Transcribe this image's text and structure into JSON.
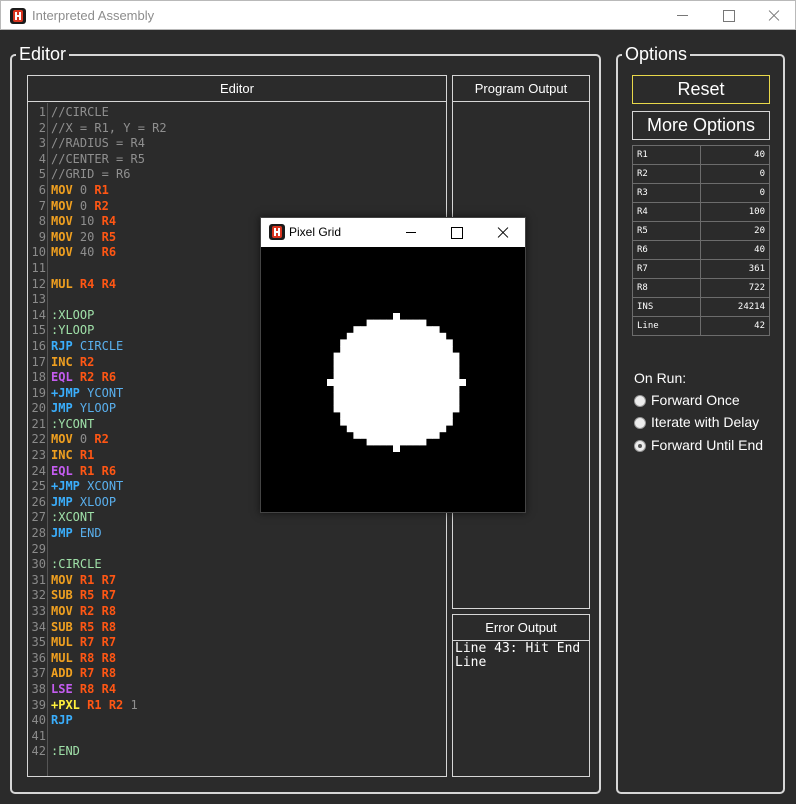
{
  "window": {
    "title": "Interpreted Assembly"
  },
  "editor_group": {
    "label": "Editor"
  },
  "options_group": {
    "label": "Options"
  },
  "editor_panel": {
    "header": "Editor",
    "lines": [
      {
        "n": "1",
        "t": [
          [
            "comment",
            "//CIRCLE"
          ]
        ]
      },
      {
        "n": "2",
        "t": [
          [
            "comment",
            "//X = R1, Y = R2"
          ]
        ]
      },
      {
        "n": "3",
        "t": [
          [
            "comment",
            "//RADIUS = R4"
          ]
        ]
      },
      {
        "n": "4",
        "t": [
          [
            "comment",
            "//CENTER = R5"
          ]
        ]
      },
      {
        "n": "5",
        "t": [
          [
            "comment",
            "//GRID = R6"
          ]
        ]
      },
      {
        "n": "6",
        "t": [
          [
            "t-orange",
            "MOV"
          ],
          [
            "t-num",
            "0"
          ],
          [
            "t-reg",
            "R1"
          ]
        ]
      },
      {
        "n": "7",
        "t": [
          [
            "t-orange",
            "MOV"
          ],
          [
            "t-num",
            "0"
          ],
          [
            "t-reg",
            "R2"
          ]
        ]
      },
      {
        "n": "8",
        "t": [
          [
            "t-orange",
            "MOV"
          ],
          [
            "t-num",
            "10"
          ],
          [
            "t-reg",
            "R4"
          ]
        ]
      },
      {
        "n": "9",
        "t": [
          [
            "t-orange",
            "MOV"
          ],
          [
            "t-num",
            "20"
          ],
          [
            "t-reg",
            "R5"
          ]
        ]
      },
      {
        "n": "10",
        "t": [
          [
            "t-orange",
            "MOV"
          ],
          [
            "t-num",
            "40"
          ],
          [
            "t-reg",
            "R6"
          ]
        ]
      },
      {
        "n": "11",
        "t": []
      },
      {
        "n": "12",
        "t": [
          [
            "t-orange",
            "MUL"
          ],
          [
            "t-reg",
            "R4"
          ],
          [
            "t-reg",
            "R4"
          ]
        ]
      },
      {
        "n": "13",
        "t": []
      },
      {
        "n": "14",
        "t": [
          [
            "t-green",
            ":XLOOP"
          ]
        ]
      },
      {
        "n": "15",
        "t": [
          [
            "t-green",
            ":YLOOP"
          ]
        ]
      },
      {
        "n": "16",
        "t": [
          [
            "t-blue",
            "RJP"
          ],
          [
            "t-label",
            "CIRCLE"
          ]
        ]
      },
      {
        "n": "17",
        "t": [
          [
            "t-orange",
            "INC"
          ],
          [
            "t-reg",
            "R2"
          ]
        ]
      },
      {
        "n": "18",
        "t": [
          [
            "t-purple",
            "EQL"
          ],
          [
            "t-reg",
            "R2"
          ],
          [
            "t-reg",
            "R6"
          ]
        ]
      },
      {
        "n": "19",
        "t": [
          [
            "t-blue",
            "+JMP"
          ],
          [
            "t-label",
            "YCONT"
          ]
        ]
      },
      {
        "n": "20",
        "t": [
          [
            "t-blue",
            "JMP"
          ],
          [
            "t-label",
            "YLOOP"
          ]
        ]
      },
      {
        "n": "21",
        "t": [
          [
            "t-green",
            ":YCONT"
          ]
        ]
      },
      {
        "n": "22",
        "t": [
          [
            "t-orange",
            "MOV"
          ],
          [
            "t-num",
            "0"
          ],
          [
            "t-reg",
            "R2"
          ]
        ]
      },
      {
        "n": "23",
        "t": [
          [
            "t-orange",
            "INC"
          ],
          [
            "t-reg",
            "R1"
          ]
        ]
      },
      {
        "n": "24",
        "t": [
          [
            "t-purple",
            "EQL"
          ],
          [
            "t-reg",
            "R1"
          ],
          [
            "t-reg",
            "R6"
          ]
        ]
      },
      {
        "n": "25",
        "t": [
          [
            "t-blue",
            "+JMP"
          ],
          [
            "t-label",
            "XCONT"
          ]
        ]
      },
      {
        "n": "26",
        "t": [
          [
            "t-blue",
            "JMP"
          ],
          [
            "t-label",
            "XLOOP"
          ]
        ]
      },
      {
        "n": "27",
        "t": [
          [
            "t-green",
            ":XCONT"
          ]
        ]
      },
      {
        "n": "28",
        "t": [
          [
            "t-blue",
            "JMP"
          ],
          [
            "t-label",
            "END"
          ]
        ]
      },
      {
        "n": "29",
        "t": []
      },
      {
        "n": "30",
        "t": [
          [
            "t-green",
            ":CIRCLE"
          ]
        ]
      },
      {
        "n": "31",
        "t": [
          [
            "t-orange",
            "MOV"
          ],
          [
            "t-reg",
            "R1"
          ],
          [
            "t-reg",
            "R7"
          ]
        ]
      },
      {
        "n": "32",
        "t": [
          [
            "t-orange",
            "SUB"
          ],
          [
            "t-reg",
            "R5"
          ],
          [
            "t-reg",
            "R7"
          ]
        ]
      },
      {
        "n": "33",
        "t": [
          [
            "t-orange",
            "MOV"
          ],
          [
            "t-reg",
            "R2"
          ],
          [
            "t-reg",
            "R8"
          ]
        ]
      },
      {
        "n": "34",
        "t": [
          [
            "t-orange",
            "SUB"
          ],
          [
            "t-reg",
            "R5"
          ],
          [
            "t-reg",
            "R8"
          ]
        ]
      },
      {
        "n": "35",
        "t": [
          [
            "t-orange",
            "MUL"
          ],
          [
            "t-reg",
            "R7"
          ],
          [
            "t-reg",
            "R7"
          ]
        ]
      },
      {
        "n": "36",
        "t": [
          [
            "t-orange",
            "MUL"
          ],
          [
            "t-reg",
            "R8"
          ],
          [
            "t-reg",
            "R8"
          ]
        ]
      },
      {
        "n": "37",
        "t": [
          [
            "t-orange",
            "ADD"
          ],
          [
            "t-reg",
            "R7"
          ],
          [
            "t-reg",
            "R8"
          ]
        ]
      },
      {
        "n": "38",
        "t": [
          [
            "t-purple",
            "LSE"
          ],
          [
            "t-reg",
            "R8"
          ],
          [
            "t-reg",
            "R4"
          ]
        ]
      },
      {
        "n": "39",
        "t": [
          [
            "t-yellow",
            "+PXL"
          ],
          [
            "t-reg",
            "R1"
          ],
          [
            "t-reg",
            "R2"
          ],
          [
            "t-num",
            "1"
          ]
        ]
      },
      {
        "n": "40",
        "t": [
          [
            "t-blue",
            "RJP"
          ]
        ]
      },
      {
        "n": "41",
        "t": []
      },
      {
        "n": "42",
        "t": [
          [
            "t-green",
            ":END"
          ]
        ]
      }
    ]
  },
  "program_output": {
    "header": "Program Output",
    "text": ""
  },
  "error_output": {
    "header": "Error Output",
    "text": "Line 43: Hit End Line"
  },
  "pixel_grid": {
    "title": "Pixel Grid",
    "grid_size": 40,
    "center": 20,
    "radius_squared": 100,
    "on_color": "#ffffff",
    "off_color": "#000000"
  },
  "options": {
    "reset_label": "Reset",
    "more_options_label": "More Options",
    "registers": [
      {
        "name": "R1",
        "value": "40"
      },
      {
        "name": "R2",
        "value": "0"
      },
      {
        "name": "R3",
        "value": "0"
      },
      {
        "name": "R4",
        "value": "100"
      },
      {
        "name": "R5",
        "value": "20"
      },
      {
        "name": "R6",
        "value": "40"
      },
      {
        "name": "R7",
        "value": "361"
      },
      {
        "name": "R8",
        "value": "722"
      },
      {
        "name": "INS",
        "value": "24214"
      },
      {
        "name": "Line",
        "value": "42"
      }
    ],
    "on_run_label": "On Run:",
    "run_modes": [
      {
        "label": "Forward Once",
        "selected": false
      },
      {
        "label": "Iterate with Delay",
        "selected": false
      },
      {
        "label": "Forward Until End",
        "selected": true
      }
    ]
  },
  "colors": {
    "background": "#2b2b2b",
    "reset_border": "#e8d84a",
    "comment": "#8f8f8f"
  }
}
